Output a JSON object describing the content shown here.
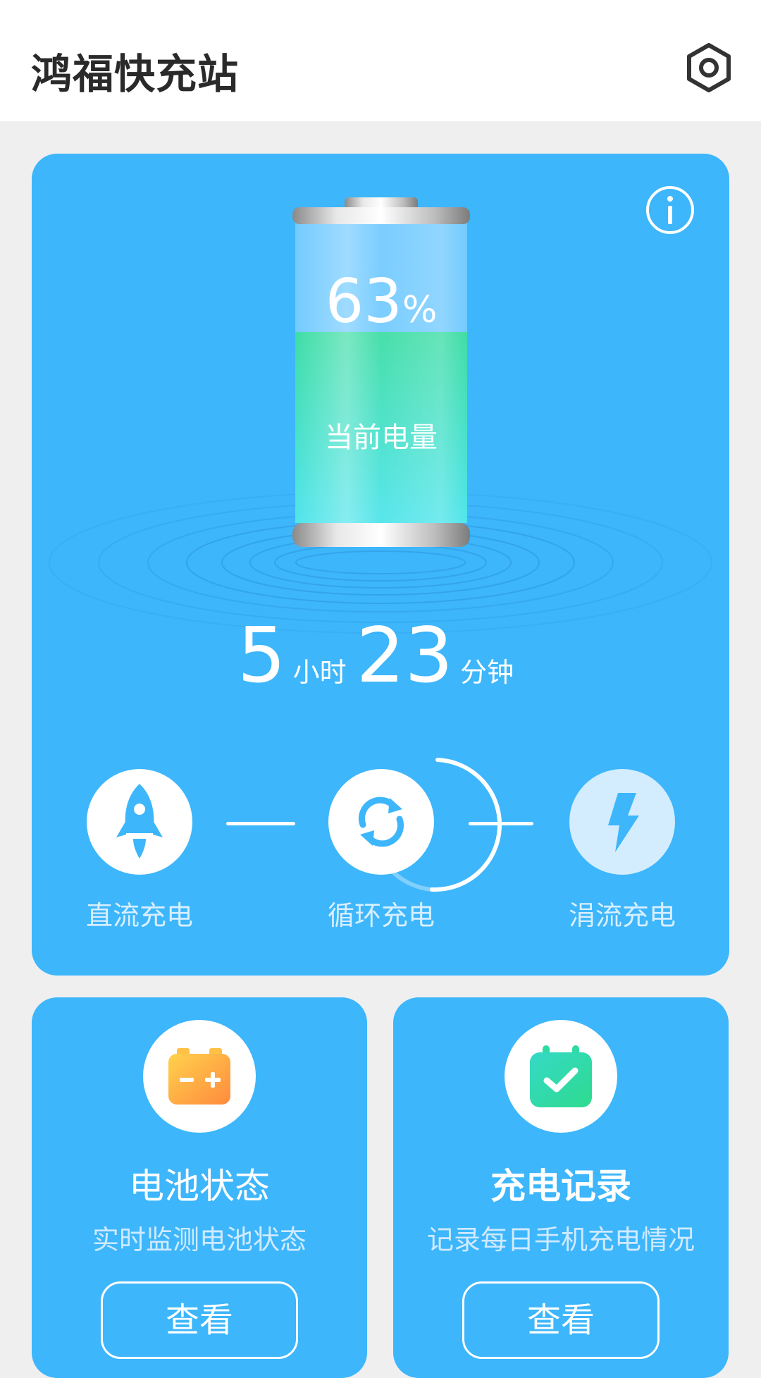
{
  "header": {
    "title": "鸿福快充站",
    "settings_icon": "gear-icon"
  },
  "battery": {
    "percent_value": "63",
    "percent_unit": "%",
    "level": 0.63,
    "label": "当前电量",
    "info_icon": "info-icon"
  },
  "remaining_time": {
    "hours": "5",
    "hours_unit": "小时",
    "minutes": "23",
    "minutes_unit": "分钟"
  },
  "charge_modes": [
    {
      "label": "直流充电",
      "icon": "rocket-icon"
    },
    {
      "label": "循环充电",
      "icon": "cycle-icon",
      "active": true
    },
    {
      "label": "涓流充电",
      "icon": "lightning-icon"
    }
  ],
  "cards": [
    {
      "title": "电池状态",
      "desc": "实时监测电池状态",
      "button": "查看",
      "icon": "battery-status-icon"
    },
    {
      "title": "充电记录",
      "desc": "记录每日手机充电情况",
      "button": "查看",
      "icon": "calendar-check-icon"
    }
  ],
  "colors": {
    "accent": "#3db6fb",
    "battery_fill": "#34dba0",
    "battery_fill_bottom": "#46e3ea",
    "card_icon_orange": "#ff9b3d",
    "card_icon_green": "#2edba2"
  }
}
